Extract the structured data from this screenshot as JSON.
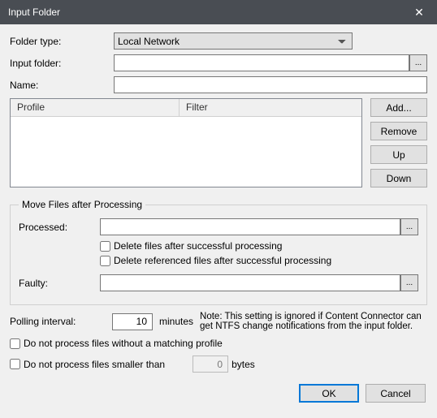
{
  "window": {
    "title": "Input Folder",
    "close_glyph": "✕"
  },
  "labels": {
    "folder_type": "Folder type:",
    "input_folder": "Input folder:",
    "name": "Name:",
    "processed": "Processed:",
    "faulty": "Faulty:",
    "polling": "Polling interval:",
    "minutes": "minutes",
    "bytes": "bytes"
  },
  "values": {
    "folder_type": "Local Network",
    "input_folder": "",
    "name": "",
    "processed": "",
    "faulty": "",
    "polling": "10",
    "min_size": "0"
  },
  "grid": {
    "col1": "Profile",
    "col2": "Filter"
  },
  "buttons": {
    "add": "Add...",
    "remove": "Remove",
    "up": "Up",
    "down": "Down",
    "ok": "OK",
    "cancel": "Cancel",
    "browse": "..."
  },
  "fieldset": {
    "legend": "Move Files after Processing"
  },
  "checks": {
    "delete_after": "Delete files after successful processing",
    "delete_referenced": "Delete referenced files after successful processing",
    "no_matching": "Do not process files without a matching profile",
    "smaller_than": "Do not process files smaller than"
  },
  "note": "Note: This setting is ignored if Content Connector can get NTFS change notifications from the input folder."
}
